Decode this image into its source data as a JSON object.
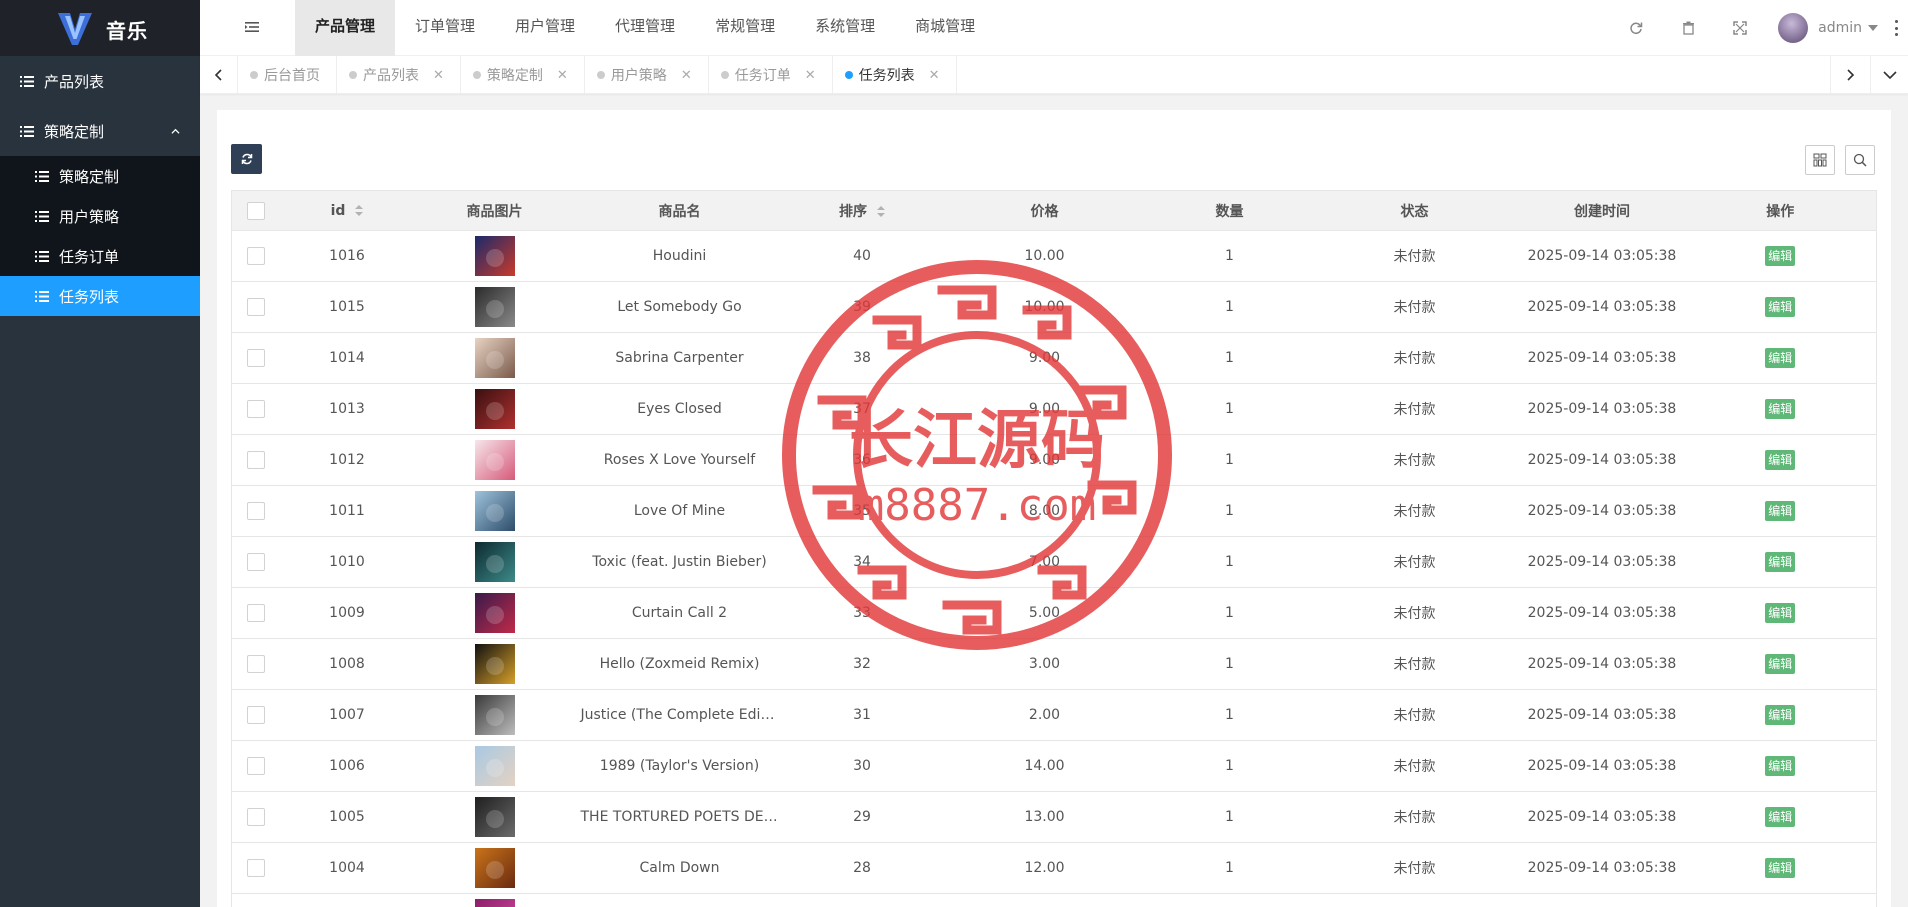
{
  "app": {
    "name": "音乐"
  },
  "sidebar": {
    "items": [
      {
        "label": "产品列表"
      },
      {
        "label": "策略定制"
      }
    ],
    "sub_items": [
      {
        "label": "策略定制"
      },
      {
        "label": "用户策略"
      },
      {
        "label": "任务订单"
      },
      {
        "label": "任务列表",
        "active": true
      }
    ]
  },
  "header": {
    "tabs": [
      {
        "label": "产品管理",
        "active": true
      },
      {
        "label": "订单管理"
      },
      {
        "label": "用户管理"
      },
      {
        "label": "代理管理"
      },
      {
        "label": "常规管理"
      },
      {
        "label": "系统管理"
      },
      {
        "label": "商城管理"
      }
    ],
    "user": "admin"
  },
  "page_tabs": [
    {
      "label": "后台首页",
      "closable": false
    },
    {
      "label": "产品列表",
      "closable": true
    },
    {
      "label": "策略定制",
      "closable": true
    },
    {
      "label": "用户策略",
      "closable": true
    },
    {
      "label": "任务订单",
      "closable": true
    },
    {
      "label": "任务列表",
      "closable": true,
      "active": true
    }
  ],
  "table": {
    "columns": [
      "id",
      "商品图片",
      "商品名",
      "排序",
      "价格",
      "数量",
      "状态",
      "创建时间",
      "操作"
    ],
    "edit_label": "编辑",
    "rows": [
      {
        "id": "1016",
        "name": "Houdini",
        "sort": "40",
        "price": "10.00",
        "qty": "1",
        "status": "未付款",
        "created": "2025-09-14 03:05:38",
        "cover": [
          "#1b2a6b",
          "#c93a2a"
        ]
      },
      {
        "id": "1015",
        "name": "Let Somebody Go",
        "sort": "39",
        "price": "10.00",
        "qty": "1",
        "status": "未付款",
        "created": "2025-09-14 03:05:38",
        "cover": [
          "#2b2b2b",
          "#8a8a8a"
        ]
      },
      {
        "id": "1014",
        "name": "Sabrina Carpenter",
        "sort": "38",
        "price": "9.00",
        "qty": "1",
        "status": "未付款",
        "created": "2025-09-14 03:05:38",
        "cover": [
          "#e8d3c3",
          "#7a5a4a"
        ]
      },
      {
        "id": "1013",
        "name": "Eyes Closed",
        "sort": "37",
        "price": "9.00",
        "qty": "1",
        "status": "未付款",
        "created": "2025-09-14 03:05:38",
        "cover": [
          "#3a1010",
          "#b03030"
        ]
      },
      {
        "id": "1012",
        "name": "Roses X Love Yourself",
        "sort": "36",
        "price": "9.00",
        "qty": "1",
        "status": "未付款",
        "created": "2025-09-14 03:05:38",
        "cover": [
          "#f6e6ea",
          "#d65a7a"
        ]
      },
      {
        "id": "1011",
        "name": "Love Of Mine",
        "sort": "35",
        "price": "8.00",
        "qty": "1",
        "status": "未付款",
        "created": "2025-09-14 03:05:38",
        "cover": [
          "#9fc3dc",
          "#2d4d6b"
        ]
      },
      {
        "id": "1010",
        "name": "Toxic (feat. Justin Bieber)",
        "sort": "34",
        "price": "7.00",
        "qty": "1",
        "status": "未付款",
        "created": "2025-09-14 03:05:38",
        "cover": [
          "#0d2a30",
          "#3d8a8a"
        ]
      },
      {
        "id": "1009",
        "name": "Curtain Call 2",
        "sort": "33",
        "price": "5.00",
        "qty": "1",
        "status": "未付款",
        "created": "2025-09-14 03:05:38",
        "cover": [
          "#3a1a4a",
          "#c02a4a"
        ]
      },
      {
        "id": "1008",
        "name": "Hello (Zoxmeid Remix)",
        "sort": "32",
        "price": "3.00",
        "qty": "1",
        "status": "未付款",
        "created": "2025-09-14 03:05:38",
        "cover": [
          "#111111",
          "#d6a02a"
        ]
      },
      {
        "id": "1007",
        "name": "Justice (The Complete Edition)",
        "sort": "31",
        "price": "2.00",
        "qty": "1",
        "status": "未付款",
        "created": "2025-09-14 03:05:38",
        "cover": [
          "#3a3a3a",
          "#bdbdbd"
        ]
      },
      {
        "id": "1006",
        "name": "1989 (Taylor's Version)",
        "sort": "30",
        "price": "14.00",
        "qty": "1",
        "status": "未付款",
        "created": "2025-09-14 03:05:38",
        "cover": [
          "#a9c9e3",
          "#e4d2c2"
        ]
      },
      {
        "id": "1005",
        "name": "THE TORTURED POETS DEPARTMENT",
        "sort": "29",
        "price": "13.00",
        "qty": "1",
        "status": "未付款",
        "created": "2025-09-14 03:05:38",
        "cover": [
          "#1f1f1f",
          "#6b6b6b"
        ]
      },
      {
        "id": "1004",
        "name": "Calm Down",
        "sort": "28",
        "price": "12.00",
        "qty": "1",
        "status": "未付款",
        "created": "2025-09-14 03:05:38",
        "cover": [
          "#c9741a",
          "#6a2a10"
        ]
      },
      {
        "id": "",
        "name": "",
        "sort": "",
        "price": "",
        "qty": "",
        "status": "",
        "created": "",
        "cover": [
          "#8a1f6a",
          "#d84aa0"
        ]
      }
    ]
  },
  "watermark": {
    "title": "长江源码",
    "url": "m8887.com",
    "color": "#e23a3a"
  }
}
